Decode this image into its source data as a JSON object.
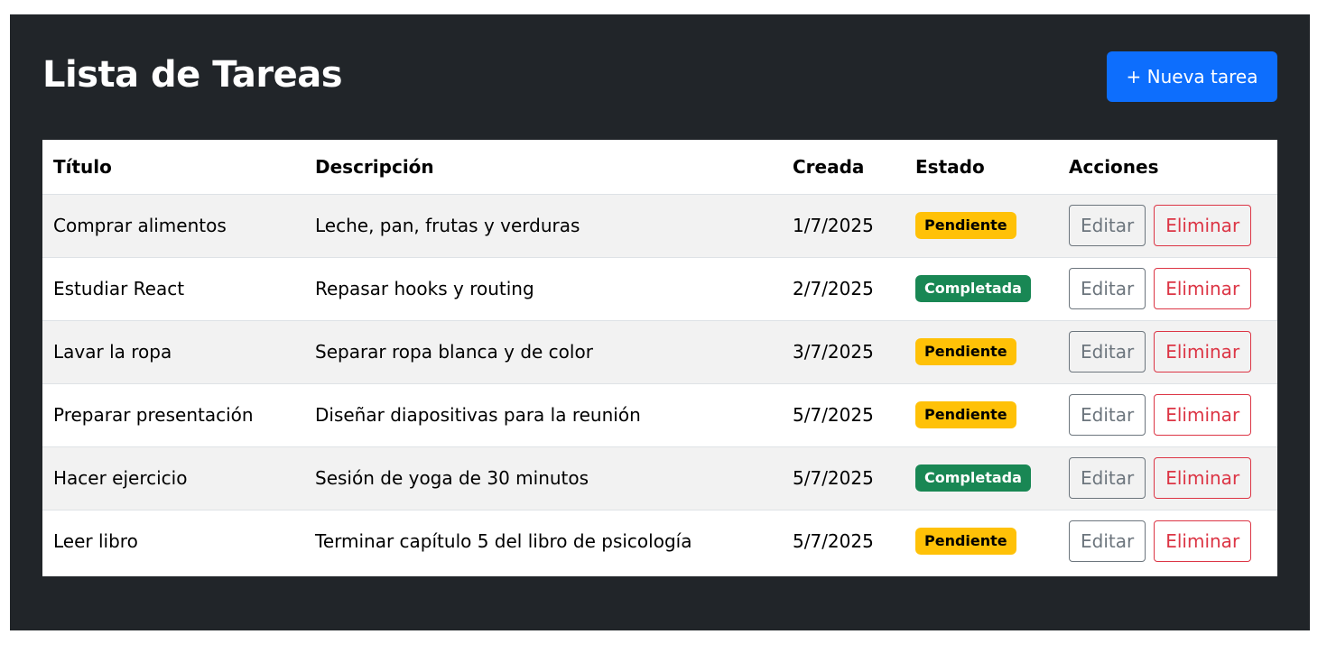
{
  "header": {
    "title": "Lista de Tareas",
    "new_button_label": "+ Nueva tarea"
  },
  "table": {
    "columns": [
      "Título",
      "Descripción",
      "Creada",
      "Estado",
      "Acciones"
    ],
    "rows": [
      {
        "title": "Comprar alimentos",
        "description": "Leche, pan, frutas y verduras",
        "created": "1/7/2025",
        "status": "Pendiente",
        "status_kind": "pending",
        "edit_label": "Editar",
        "delete_label": "Eliminar"
      },
      {
        "title": "Estudiar React",
        "description": "Repasar hooks y routing",
        "created": "2/7/2025",
        "status": "Completada",
        "status_kind": "done",
        "edit_label": "Editar",
        "delete_label": "Eliminar"
      },
      {
        "title": "Lavar la ropa",
        "description": "Separar ropa blanca y de color",
        "created": "3/7/2025",
        "status": "Pendiente",
        "status_kind": "pending",
        "edit_label": "Editar",
        "delete_label": "Eliminar"
      },
      {
        "title": "Preparar presentación",
        "description": "Diseñar diapositivas para la reunión",
        "created": "5/7/2025",
        "status": "Pendiente",
        "status_kind": "pending",
        "edit_label": "Editar",
        "delete_label": "Eliminar"
      },
      {
        "title": "Hacer ejercicio",
        "description": "Sesión de yoga de 30 minutos",
        "created": "5/7/2025",
        "status": "Completada",
        "status_kind": "done",
        "edit_label": "Editar",
        "delete_label": "Eliminar"
      },
      {
        "title": "Leer libro",
        "description": "Terminar capítulo 5 del libro de psicología",
        "created": "5/7/2025",
        "status": "Pendiente",
        "status_kind": "pending",
        "edit_label": "Editar",
        "delete_label": "Eliminar"
      }
    ]
  },
  "colors": {
    "panel_background": "#212529",
    "primary": "#0d6efd",
    "pending_badge": "#ffc107",
    "done_badge": "#198754",
    "edit_outline": "#6c757d",
    "delete_outline": "#dc3545"
  }
}
